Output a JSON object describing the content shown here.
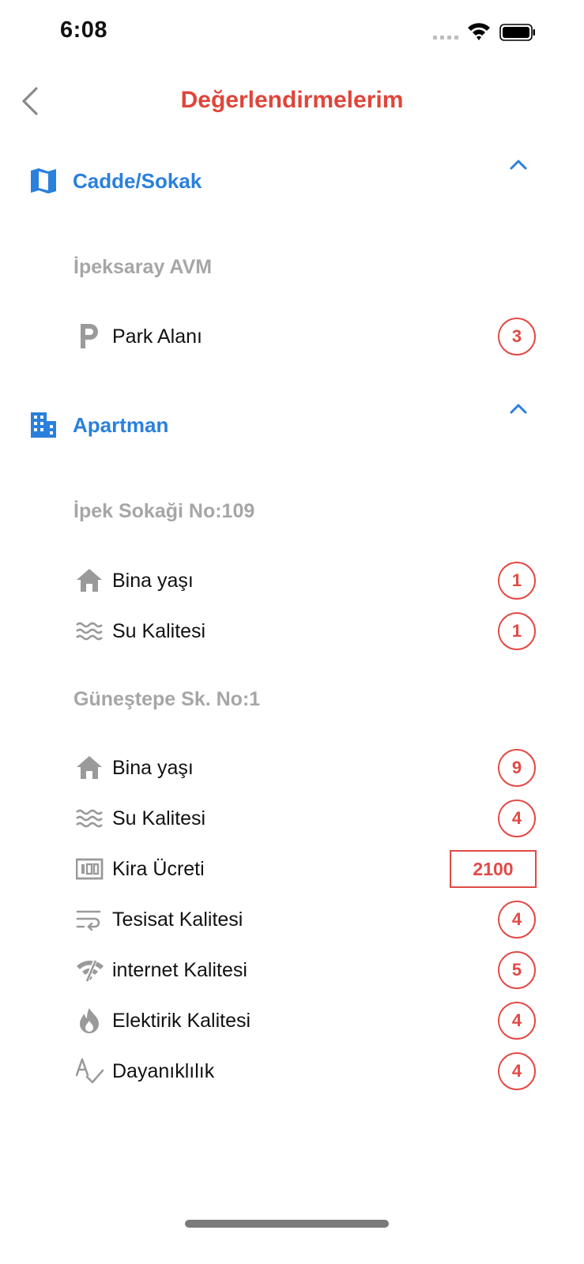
{
  "status_bar": {
    "time": "6:08"
  },
  "nav": {
    "title": "Değerlendirmelerim",
    "back_icon": "chevron-left-icon"
  },
  "colors": {
    "title": "#e0453a",
    "section": "#2a80dc",
    "badge": "#e24a46",
    "subtitle": "#a6a6a6",
    "icon": "#9a9a9a"
  },
  "sections": [
    {
      "title": "Cadde/Sokak",
      "icon": "map-icon",
      "groups": [
        {
          "title": "İpeksaray AVM",
          "items": [
            {
              "icon": "parking-icon",
              "label": "Park Alanı",
              "value": "3"
            }
          ]
        }
      ]
    },
    {
      "title": "Apartman",
      "icon": "building-icon",
      "groups": [
        {
          "title": "İpek Sokaği No:109",
          "items": [
            {
              "icon": "home-icon",
              "label": "Bina yaşı",
              "value": "1"
            },
            {
              "icon": "waves-icon",
              "label": "Su Kalitesi",
              "value": "1"
            }
          ]
        },
        {
          "title": "Güneştepe Sk. No:1",
          "items": [
            {
              "icon": "home-icon",
              "label": "Bina yaşı",
              "value": "9"
            },
            {
              "icon": "waves-icon",
              "label": "Su Kalitesi",
              "value": "4"
            },
            {
              "icon": "money-icon",
              "label": "Kira Ücreti",
              "value": "2100"
            },
            {
              "icon": "wrap-text-icon",
              "label": "Tesisat Kalitesi",
              "value": "4"
            },
            {
              "icon": "wifi-off-icon",
              "label": "internet Kalitesi",
              "value": "5"
            },
            {
              "icon": "flame-icon",
              "label": "Elektirik Kalitesi",
              "value": "4"
            },
            {
              "icon": "spellcheck-icon",
              "label": "Dayanıklılık",
              "value": "4"
            }
          ]
        }
      ]
    }
  ]
}
